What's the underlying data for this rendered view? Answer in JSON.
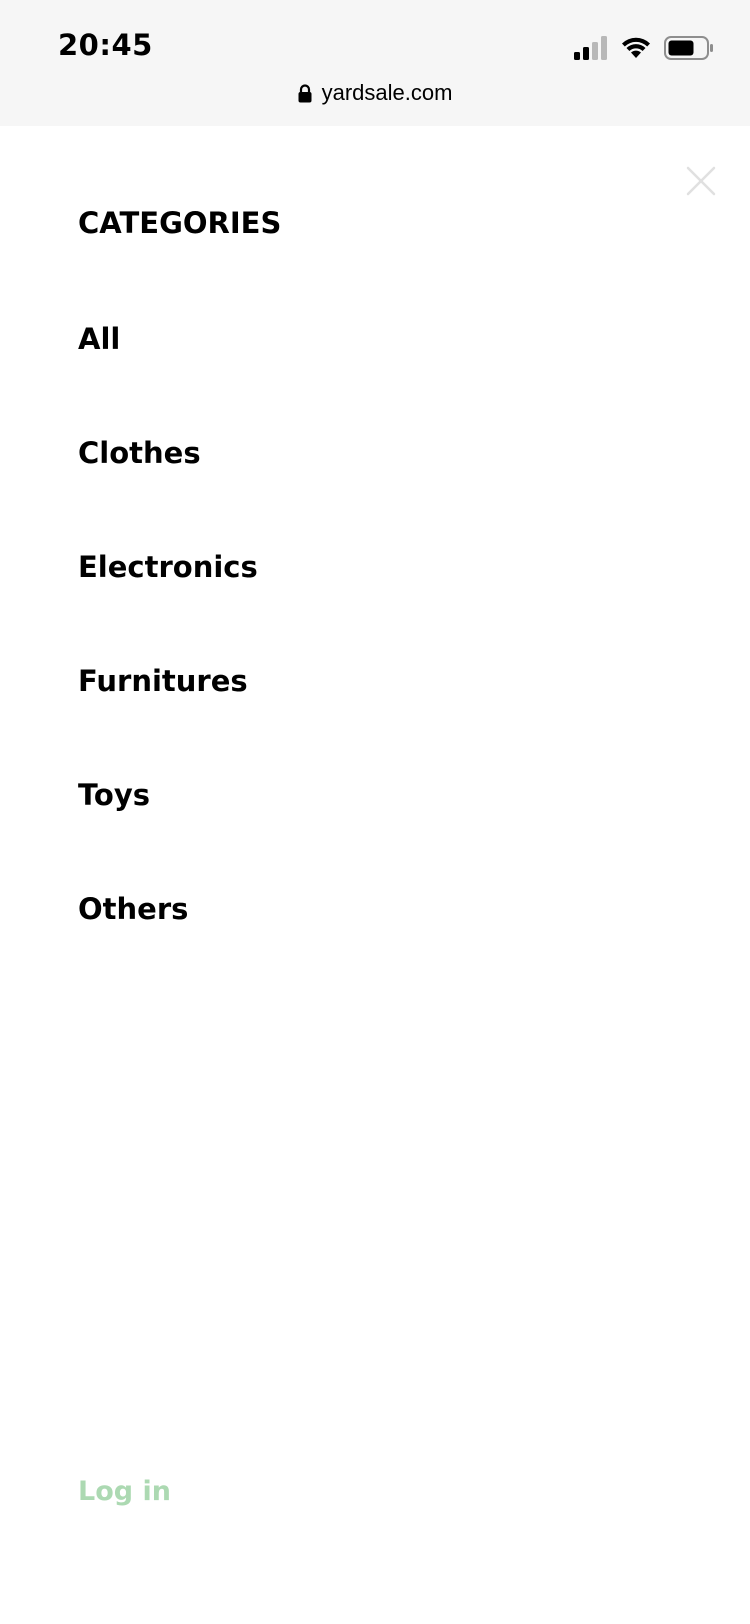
{
  "status_bar": {
    "time": "20:45",
    "icons": [
      "signal-icon",
      "wifi-icon",
      "battery-icon"
    ]
  },
  "url_bar": {
    "url": "yardsale.com",
    "icon": "lock-icon"
  },
  "menu": {
    "close_icon": "close-icon",
    "title": "CATEGORIES",
    "categories": [
      {
        "label": "All"
      },
      {
        "label": "Clothes"
      },
      {
        "label": "Electronics"
      },
      {
        "label": "Furnitures"
      },
      {
        "label": "Toys"
      },
      {
        "label": "Others"
      }
    ],
    "login_label": "Log in"
  },
  "colors": {
    "background": "#ffffff",
    "browser_bar": "#f6f6f6",
    "text": "#000000",
    "login_accent": "#acd9b2",
    "close_icon": "#e0e0e0"
  }
}
